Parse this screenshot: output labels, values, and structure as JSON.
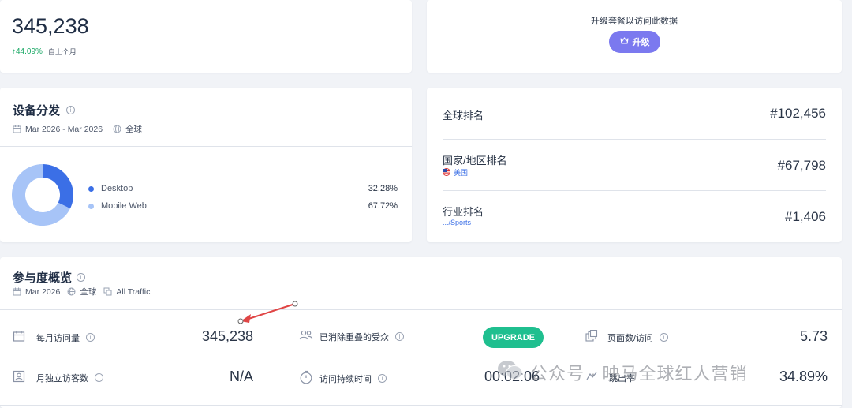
{
  "visits_card": {
    "value": "345,238",
    "change": "↑44.09%",
    "change_label": "自上个月"
  },
  "upgrade_card": {
    "prompt": "升级套餐以访问此数据",
    "button_label": "升级"
  },
  "device_card": {
    "title": "设备分发",
    "date_range": "Mar 2026 - Mar 2026",
    "region": "全球",
    "chart_data": {
      "type": "pie",
      "categories": [
        "Desktop",
        "Mobile Web"
      ],
      "values": [
        32.28,
        67.72
      ],
      "colors": [
        "#3b6fe6",
        "#a7c4f7"
      ]
    },
    "legend": [
      {
        "label": "Desktop",
        "value": "32.28%",
        "color": "#3b6fe6"
      },
      {
        "label": "Mobile Web",
        "value": "67.72%",
        "color": "#a7c4f7"
      }
    ]
  },
  "rank_card": {
    "global_label": "全球排名",
    "global_value": "#102,456",
    "country_label": "国家/地区排名",
    "country_sub": "美国",
    "country_value": "#67,798",
    "industry_label": "行业排名",
    "industry_sub": ".../Sports",
    "industry_value": "#1,406"
  },
  "engagement_card": {
    "title": "参与度概览",
    "date": "Mar 2026",
    "region": "全球",
    "traffic": "All Traffic",
    "metrics": {
      "monthly_visits_label": "每月访问量",
      "monthly_visits_value": "345,238",
      "dedup_label": "已消除重叠的受众",
      "upgrade_button": "UPGRADE",
      "pages_label": "页面数/访问",
      "pages_value": "5.73",
      "unique_label": "月独立访客数",
      "unique_value": "N/A",
      "duration_label": "访问持续时间",
      "duration_value": "00:02:06",
      "bounce_label": "跳出率",
      "bounce_value": "34.89%"
    }
  },
  "watermark": {
    "text": "公众号 · 映马全球红人营销"
  }
}
